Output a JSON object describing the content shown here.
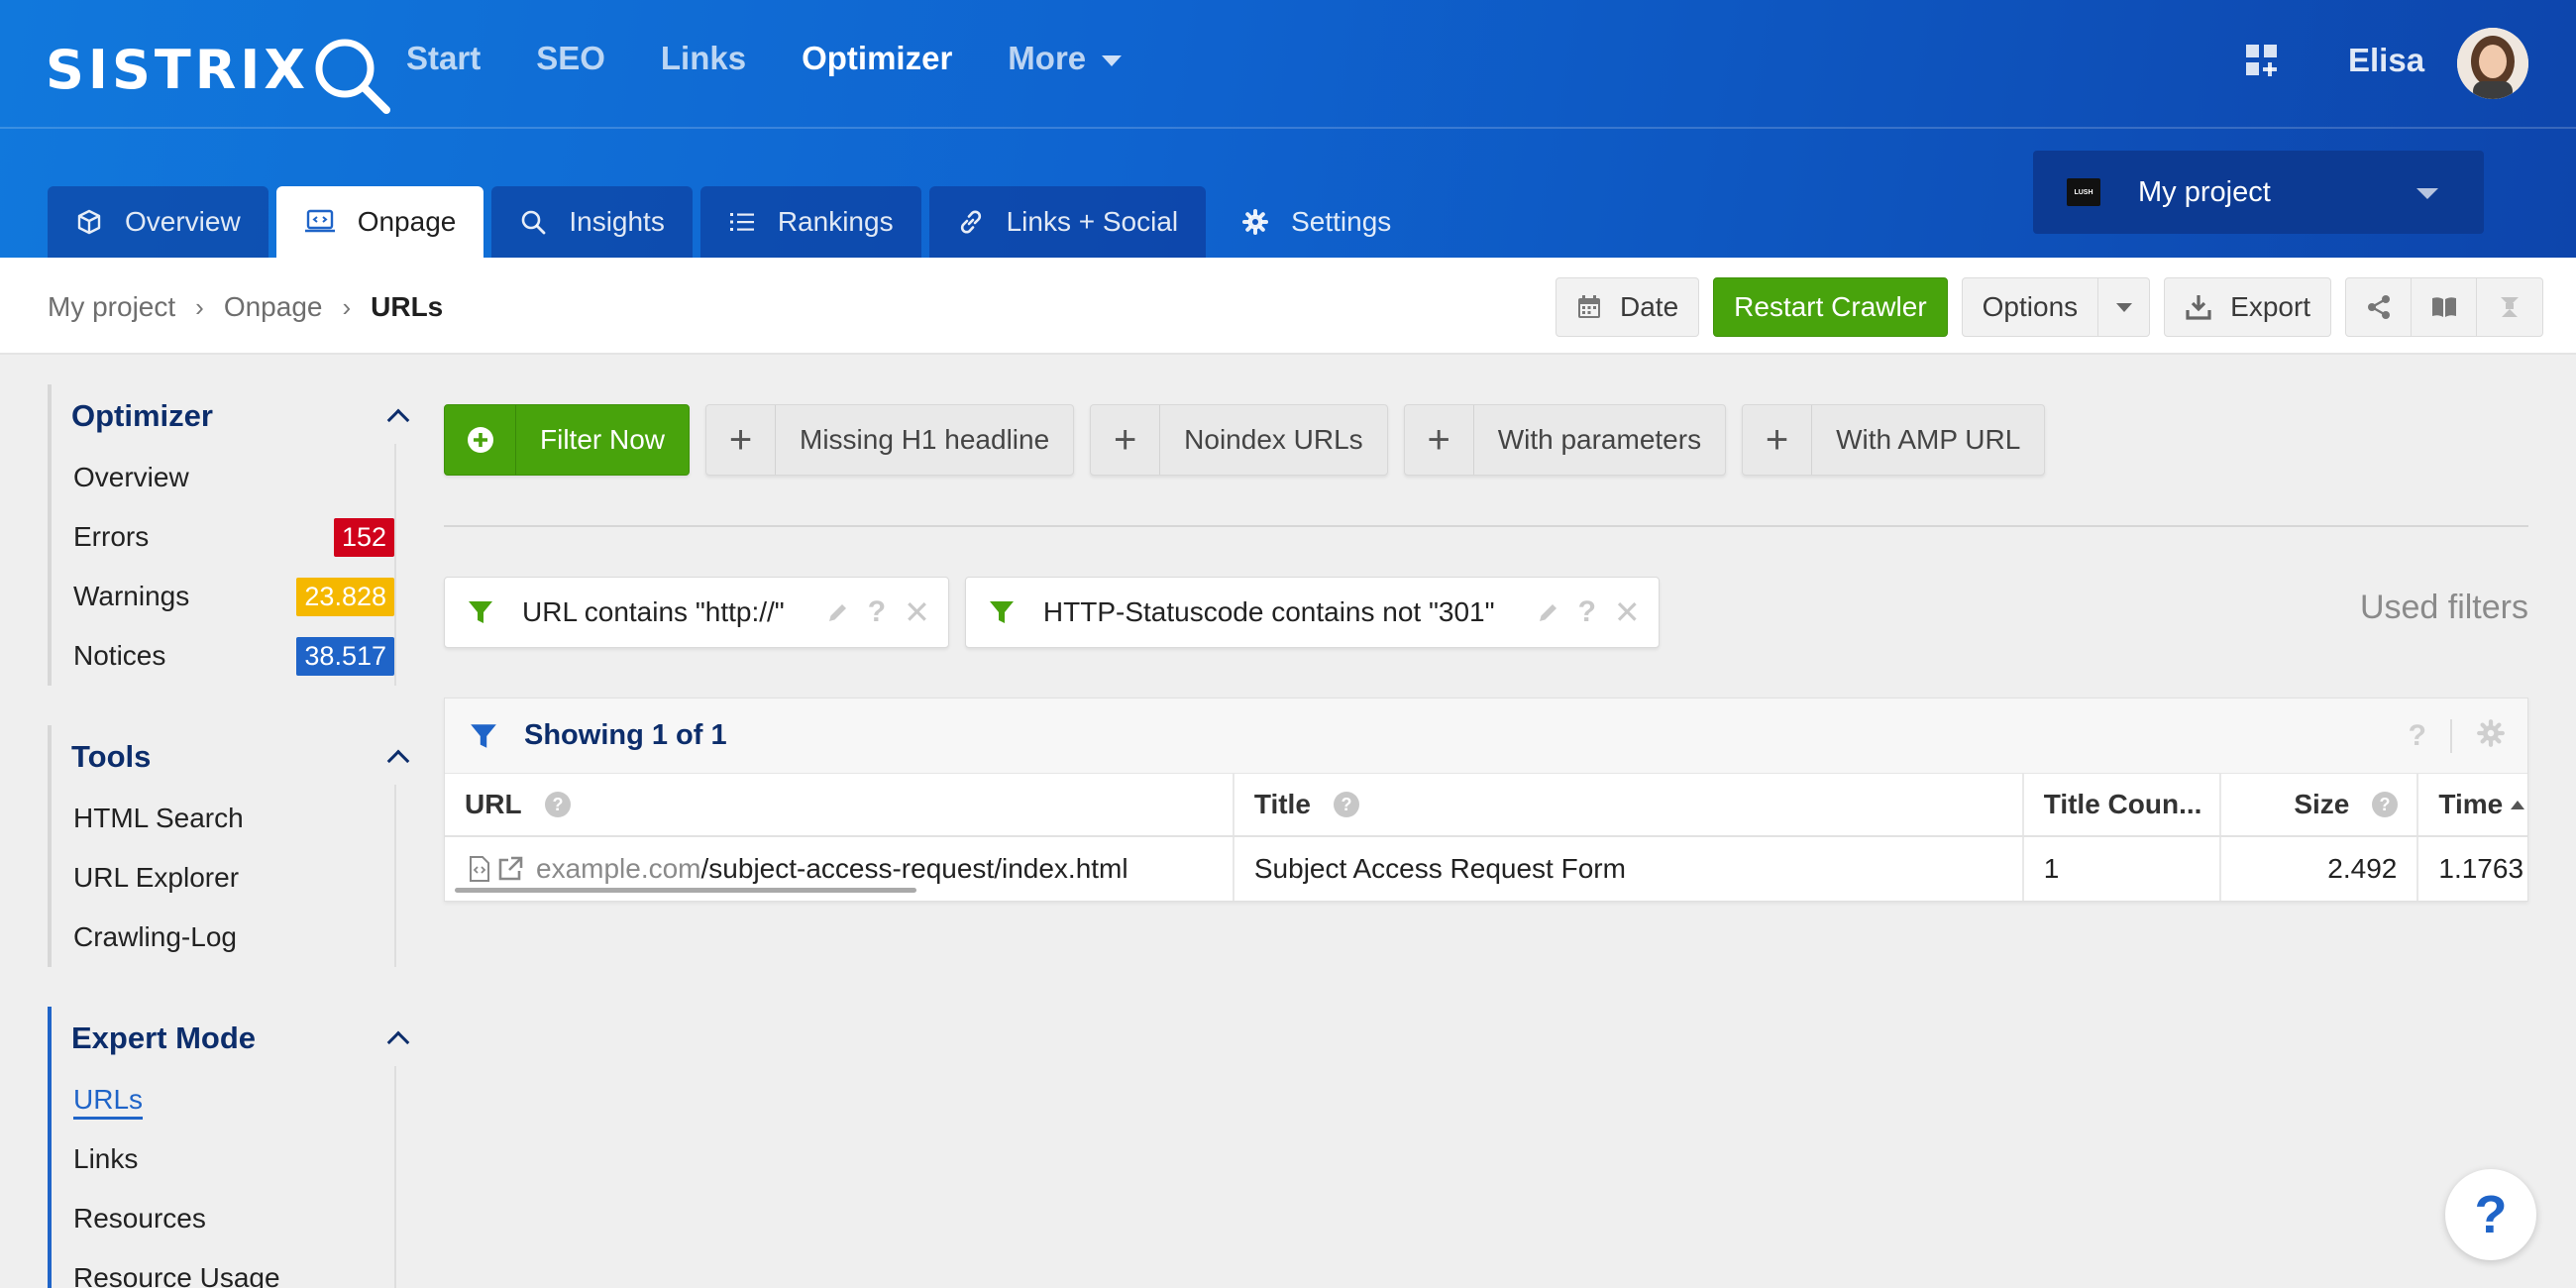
{
  "brand": {
    "name": "SISTRIX",
    "accent": "#1178dc",
    "green": "#48a30c"
  },
  "nav": {
    "items": [
      {
        "label": "Start"
      },
      {
        "label": "SEO"
      },
      {
        "label": "Links"
      },
      {
        "label": "Optimizer"
      },
      {
        "label": "More"
      }
    ],
    "active": "Optimizer",
    "user_name": "Elisa",
    "apps_icon": "apps-grid-icon"
  },
  "tabs": [
    {
      "label": "Overview",
      "icon": "cube-icon"
    },
    {
      "label": "Onpage",
      "icon": "monitor-code-icon"
    },
    {
      "label": "Insights",
      "icon": "search-icon"
    },
    {
      "label": "Rankings",
      "icon": "list-icon"
    },
    {
      "label": "Links + Social",
      "icon": "link-icon"
    },
    {
      "label": "Settings",
      "icon": "gear-icon"
    }
  ],
  "project": {
    "logo_text": "LUSH",
    "name": "My project"
  },
  "breadcrumb": {
    "items": [
      "My project",
      "Onpage",
      "URLs"
    ]
  },
  "toolbar": {
    "date_label": "Date",
    "restart_label": "Restart Crawler",
    "options_label": "Options",
    "export_label": "Export"
  },
  "sidebar": {
    "sections": [
      {
        "title": "Optimizer",
        "items": [
          {
            "label": "Overview"
          },
          {
            "label": "Errors",
            "badge": "152",
            "badge_color": "#d0021b"
          },
          {
            "label": "Warnings",
            "badge": "23.828",
            "badge_color": "#f5b800"
          },
          {
            "label": "Notices",
            "badge": "38.517",
            "badge_color": "#1f64c8"
          }
        ]
      },
      {
        "title": "Tools",
        "items": [
          {
            "label": "HTML Search"
          },
          {
            "label": "URL Explorer"
          },
          {
            "label": "Crawling-Log"
          }
        ]
      },
      {
        "title": "Expert Mode",
        "items": [
          {
            "label": "URLs"
          },
          {
            "label": "Links"
          },
          {
            "label": "Resources"
          },
          {
            "label": "Resource Usage"
          }
        ]
      }
    ]
  },
  "filters": {
    "primary_label": "Filter Now",
    "presets": [
      "Missing H1 headline",
      "Noindex URLs",
      "With parameters",
      "With AMP URL"
    ],
    "active": [
      {
        "text": "URL contains \"http://\""
      },
      {
        "text": "HTTP-Statuscode contains not \"301\""
      }
    ],
    "used_label": "Used filters"
  },
  "table": {
    "showing": "Showing 1 of 1",
    "columns": [
      "URL",
      "Title",
      "Title Coun...",
      "Size",
      "Time"
    ],
    "rows": [
      {
        "url_domain": "example.com",
        "url_path": "/subject-access-request/index.html",
        "title": "Subject Access Request Form",
        "title_count": "1",
        "size": "2.492",
        "time": "1.1763"
      }
    ]
  },
  "help_fab": "?"
}
